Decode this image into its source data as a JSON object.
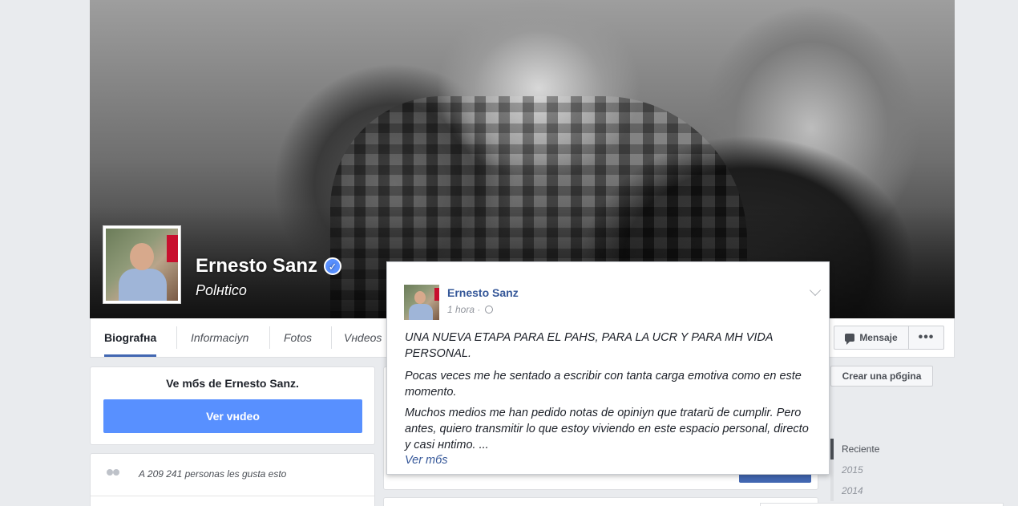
{
  "profile": {
    "name": "Ernesto Sanz",
    "category": "Polнtico"
  },
  "tabs": [
    {
      "label": "Biografнa",
      "active": true
    },
    {
      "label": "Informaciуn",
      "active": false
    },
    {
      "label": "Fotos",
      "active": false
    },
    {
      "label": "Vнdeos",
      "active": false
    }
  ],
  "actions": {
    "message_label": "Mensaje",
    "more_label": "•••",
    "create_page_label": "Crear una pбgina"
  },
  "video_card": {
    "title": "Ve mбs de Ernesto Sanz.",
    "button_label": "Ver vнdeo"
  },
  "likes": {
    "text": "A 209  241 personas les gusta esto"
  },
  "timeline": {
    "items": [
      "Reciente",
      "2015",
      "2014"
    ]
  },
  "post": {
    "author": "Ernesto Sanz",
    "time": "1 hora · ",
    "paragraphs": [
      "UNA NUEVA ETAPA PARA EL PAНS, PARA LA UCR Y PARA MН VIDA PERSONAL.",
      "Pocas veces me he sentado a escribir con tanta carga emotiva como en este momento.",
      "Muchos medios me han pedido notas de opiniуn que tratarй de cumplir. Pero antes, quiero transmitir lo que estoy viviendo en este espacio personal, directo y casi нntimo. ..."
    ],
    "see_more": "Ver mбs"
  },
  "icons": {
    "verified": "verified-badge-icon",
    "message": "message-icon",
    "people": "people-icon",
    "globe": "globe-icon",
    "chevron": "chevron-down-icon"
  },
  "colors": {
    "accent": "#4267b2",
    "button_blue": "#5890ff",
    "link": "#365899"
  }
}
